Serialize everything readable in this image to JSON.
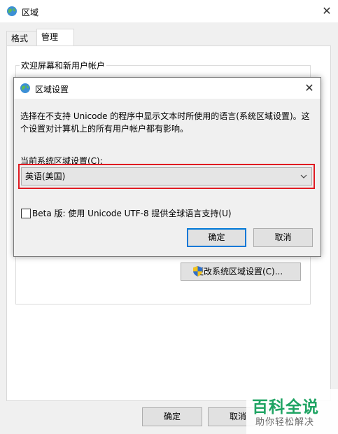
{
  "outer_window": {
    "title": "区域",
    "close_glyph": "✕",
    "tabs": [
      {
        "label": "格式",
        "active": false
      },
      {
        "label": "管理",
        "active": true
      }
    ],
    "welcome_group_label": "欢迎屏幕和新用户帐户",
    "change_locale_button": "更改系统区域设置(C)...",
    "ok_button": "确定",
    "cancel_button": "取消"
  },
  "dialog": {
    "title": "区域设置",
    "close_glyph": "✕",
    "description_line1": "选择在不支持 Unicode 的程序中显示文本时所使用的语言(系统区域设置)。这",
    "description_line2": "个设置对计算机上的所有用户帐户都有影响。",
    "locale_label": "当前系统区域设置(C):",
    "locale_selected": "英语(美国)",
    "beta_checkbox_checked": false,
    "beta_label": "Beta 版: 使用 Unicode UTF-8 提供全球语言支持(U)",
    "ok_button": "确定",
    "cancel_button": "取消"
  },
  "icons": {
    "window_icon": "globe-icon",
    "shield_icon": "uac-shield-icon",
    "dropdown_icon": "chevron-down-icon"
  },
  "colors": {
    "highlight_red": "#e01b22",
    "focus_blue": "#0078d7",
    "watermark_green": "#1fa463"
  },
  "watermark": {
    "line1": "百科全说",
    "line2": "助你轻松解决"
  }
}
